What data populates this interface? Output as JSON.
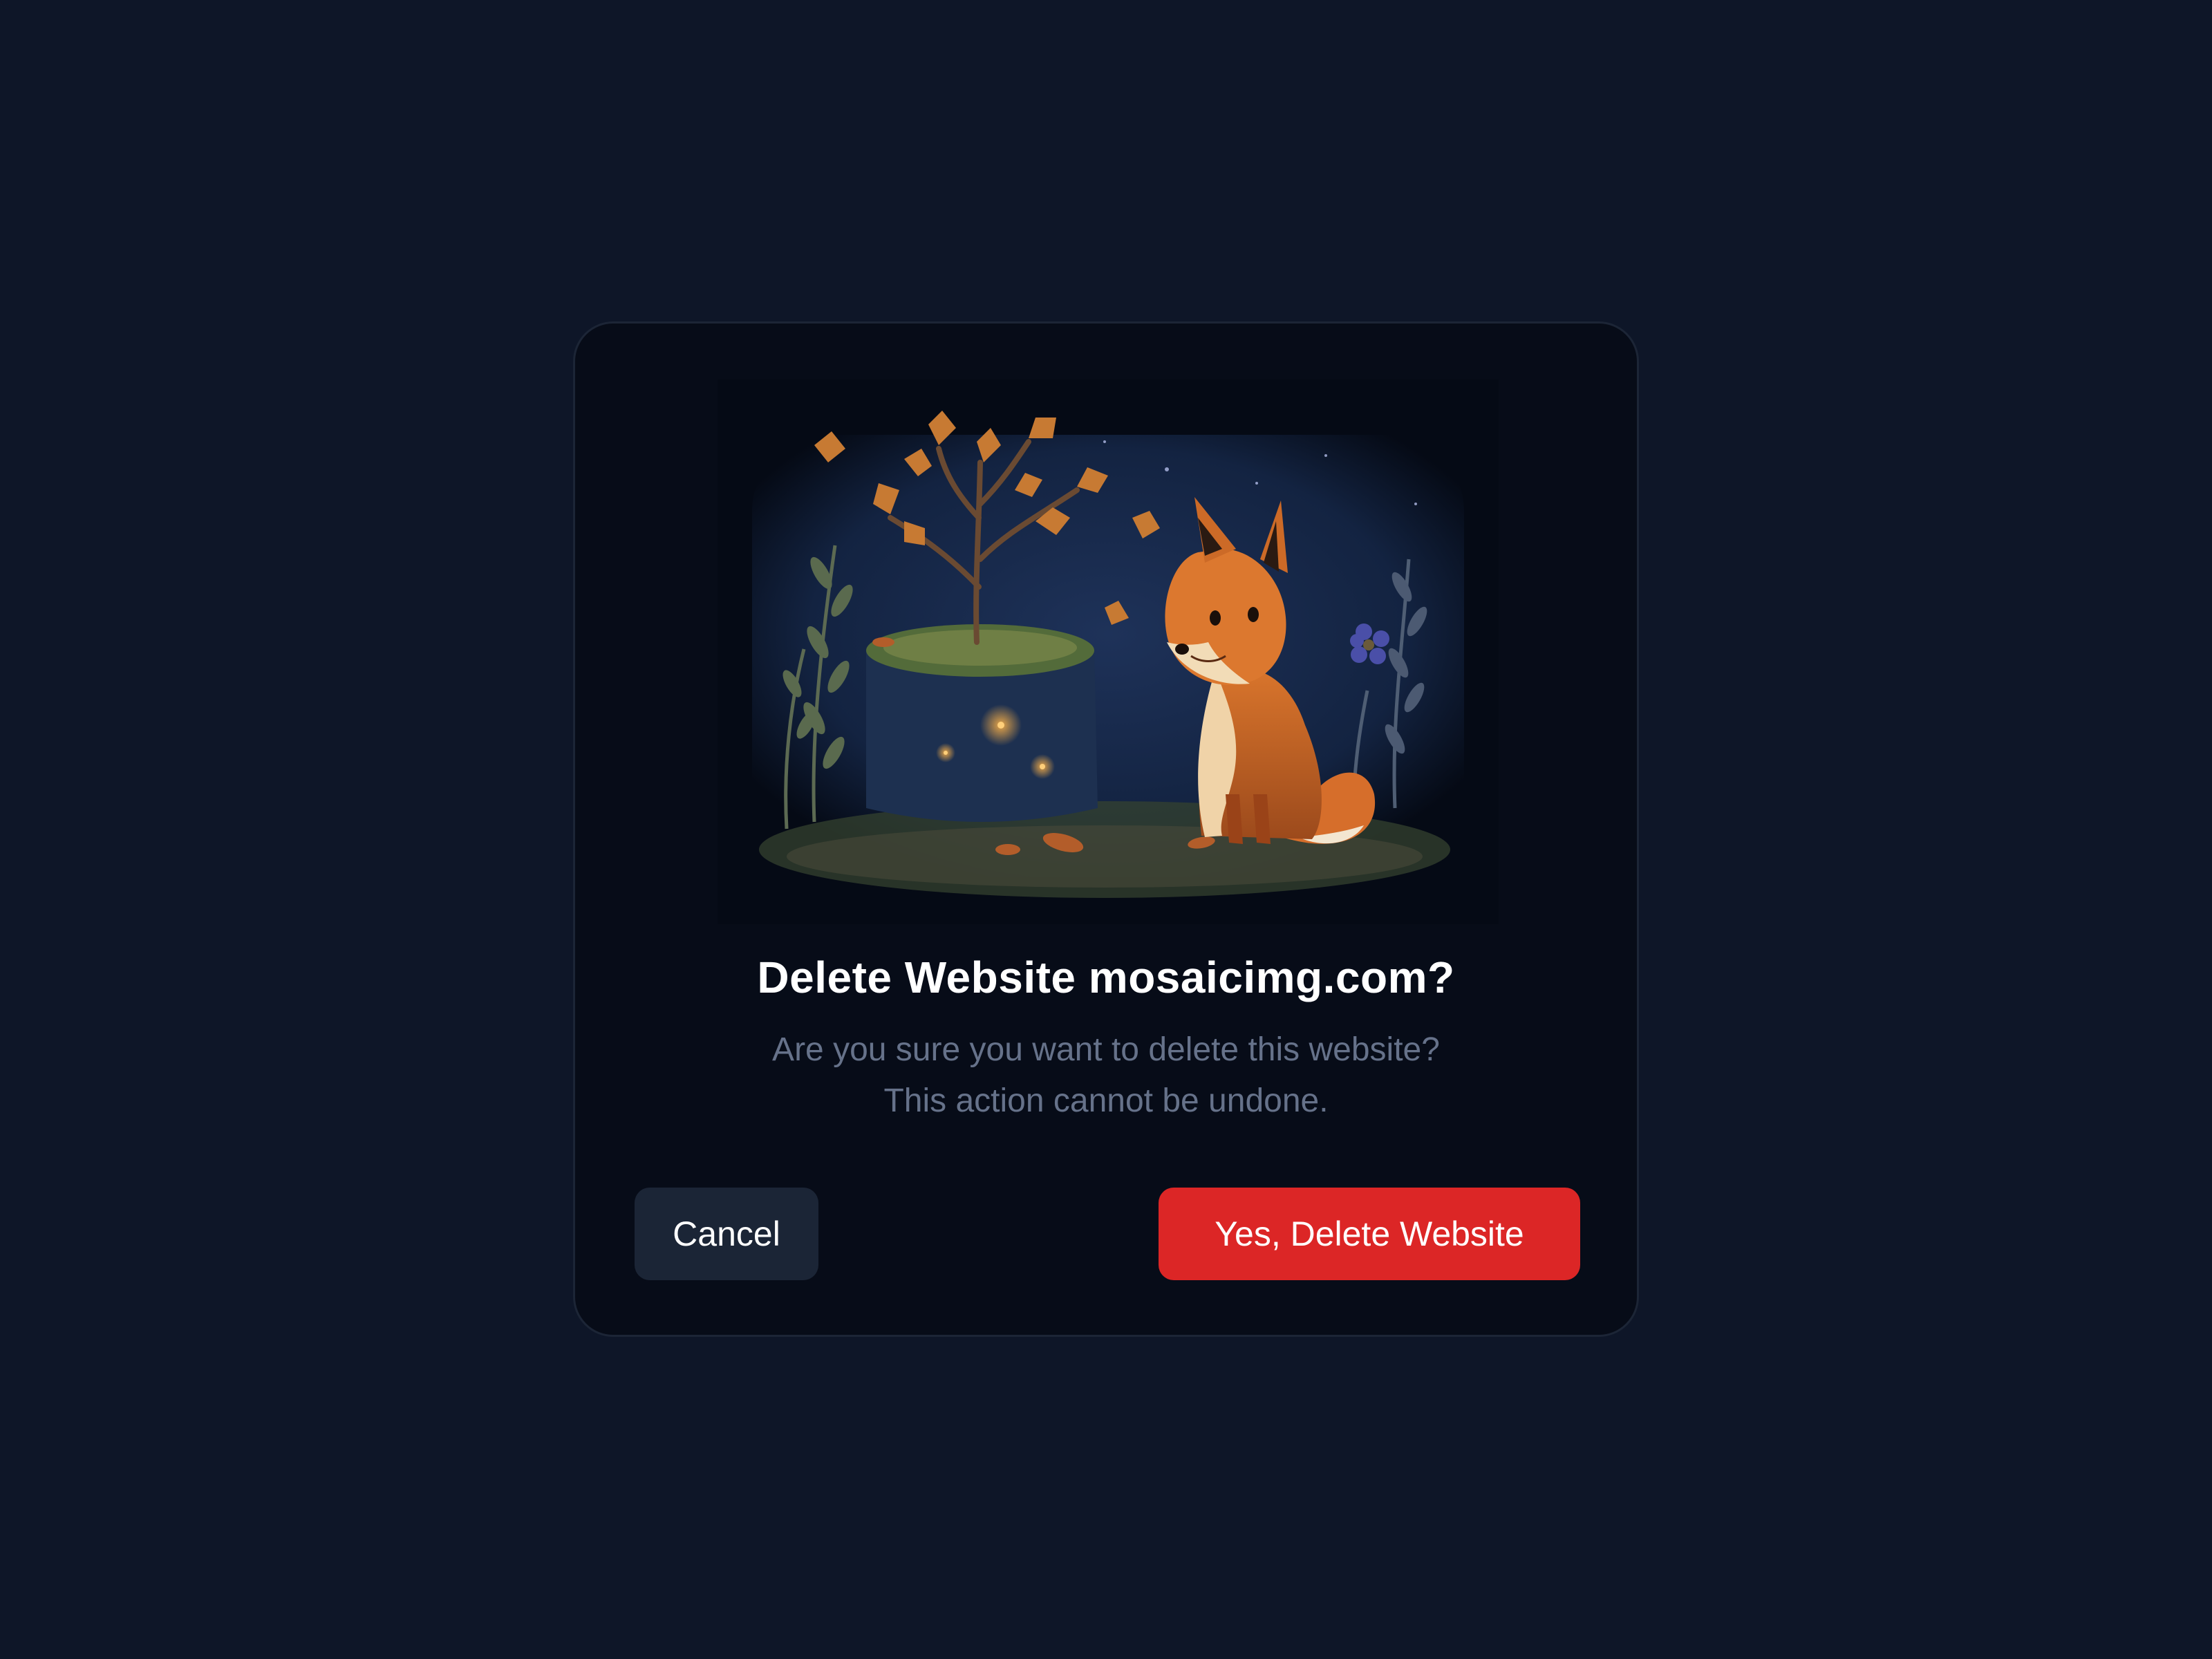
{
  "dialog": {
    "title": "Delete Website mosaicimg.com?",
    "description": "Are you sure you want to delete this website? This action cannot be undone.",
    "cancel_label": "Cancel",
    "confirm_label": "Yes, Delete Website"
  },
  "colors": {
    "page_background": "#0e1628",
    "dialog_background": "#070c18",
    "danger": "#dc2626",
    "secondary_button": "#1b2536",
    "muted_text": "#66728a"
  },
  "icons": {
    "illustration": "fox-and-tree-illustration"
  }
}
